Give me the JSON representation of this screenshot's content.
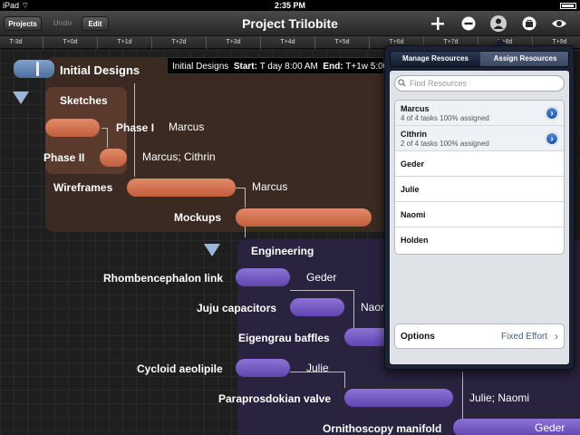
{
  "status_bar": {
    "carrier": "iPad",
    "time": "2:35 PM"
  },
  "toolbar": {
    "projects_label": "Projects",
    "undo_label": "Undo",
    "edit_label": "Edit",
    "title": "Project Trilobite",
    "icons": [
      "add-icon",
      "remove-icon",
      "person-icon",
      "briefcase-icon",
      "eye-icon"
    ]
  },
  "timeline": {
    "ticks": [
      "T-3d",
      "T+0d",
      "T+1d",
      "T+2d",
      "T+3d",
      "T+4d",
      "T+5d",
      "T+6d",
      "T+7d",
      "T+8d",
      "T+9d"
    ]
  },
  "gantt": {
    "groups": {
      "design": "Initial Designs",
      "sketches": "Sketches",
      "engineering": "Engineering"
    },
    "tasks": [
      {
        "label": "Phase I",
        "resource": "Marcus"
      },
      {
        "label": "Phase II",
        "resource": "Marcus; Cithrin"
      },
      {
        "label": "Wireframes",
        "resource": "Marcus"
      },
      {
        "label": "Mockups",
        "resource": ""
      },
      {
        "label": "Rhombencephalon link",
        "resource": "Geder"
      },
      {
        "label": "Juju capacitors",
        "resource": "Naomi"
      },
      {
        "label": "Eigengrau baffles",
        "resource": ""
      },
      {
        "label": "Cycloid aeolipile",
        "resource": "Julie"
      },
      {
        "label": "Paraprosdokian valve",
        "resource": "Julie; Naomi"
      },
      {
        "label": "Ornithoscopy manifold",
        "resource": "Geder"
      }
    ],
    "tooltip": {
      "name": "Initial Designs",
      "start_label": "Start:",
      "start_value": "T day 8:00 AM",
      "end_label": "End:",
      "end_value": "T+1w 5:00 PM"
    }
  },
  "popover": {
    "tab_manage": "Manage Resources",
    "tab_assign": "Assign Resources",
    "search_placeholder": "Find Resources",
    "resources": [
      {
        "name": "Marcus",
        "detail": "4 of 4 tasks 100% assigned"
      },
      {
        "name": "Cithrin",
        "detail": "2 of 4 tasks 100% assigned"
      },
      {
        "name": "Geder",
        "detail": ""
      },
      {
        "name": "Julie",
        "detail": ""
      },
      {
        "name": "Naomi",
        "detail": ""
      },
      {
        "name": "Holden",
        "detail": ""
      }
    ],
    "options_label": "Options",
    "options_value": "Fixed Effort"
  },
  "colors": {
    "design_bar": "#d2714e",
    "engineering_bar": "#7a5cc6",
    "accent_blue": "#2f6bc0"
  }
}
